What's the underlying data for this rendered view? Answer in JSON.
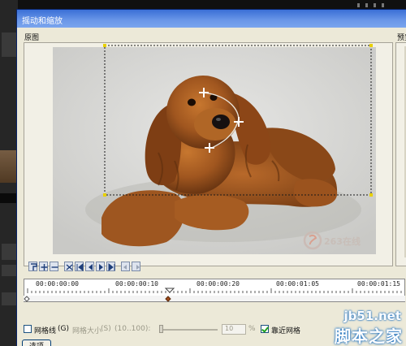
{
  "window": {
    "title": "摇动和缩放"
  },
  "panels": {
    "original_label": "原图",
    "preview_label": "预览"
  },
  "photo": {
    "watermark_text": "263在线"
  },
  "timeline": {
    "timecodes": [
      "00:00:00:00",
      "00:00:00:10",
      "00:00:00:20",
      "00:00:01:05",
      "00:00:01:15"
    ],
    "current_time_fraction": 0.38
  },
  "options": {
    "grid_checkbox_label": "网格线",
    "grid_hotkey": "(G)",
    "grid_size_label": "网格大小",
    "grid_size_hotkey": "(S)",
    "grid_size_range": "(10..100):",
    "grid_size_value": "10",
    "grid_size_unit": "%",
    "snap_label": "靠近网格",
    "options_button": "选项"
  },
  "site_watermark": {
    "line1": "jb51.net",
    "line2": "脚本之家"
  },
  "colors": {
    "titlebar": "#3a6fd6",
    "dialog_bg": "#ece9d8",
    "accent": "#1d70c0"
  }
}
